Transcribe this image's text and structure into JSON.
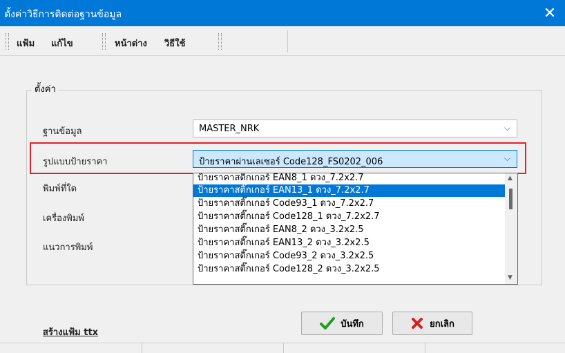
{
  "window": {
    "title": "ตั้งค่าวิธีการติดต่อฐานข้อมูล"
  },
  "menu": [
    "แฟ้ม",
    "แก้ไข",
    "หน้าต่าง",
    "วิธีใช้"
  ],
  "group": {
    "title": "ตั้งค่า"
  },
  "fields": {
    "database": {
      "label": "ฐานข้อมูล",
      "value": "MASTER_NRK"
    },
    "label_format": {
      "label": "รูปแบบป้ายราคา",
      "value": "ป้ายราคาผ่านเลเซอร์ Code128_FS0202_006"
    },
    "print_where": {
      "label": "พิมพ์ที่ใด"
    },
    "printer": {
      "label": "เครื่องพิมพ์"
    },
    "orientation": {
      "label": "แนวการพิมพ์"
    }
  },
  "dropdown_options": [
    "ป้ายราคาสติ๊กเกอร์ EAN8_1 ดวง_7.2x2.7",
    "ป้ายราคาสติ๊กเกอร์ EAN13_1 ดวง_7.2x2.7",
    "ป้ายราคาสติ๊กเกอร์ Code93_1 ดวง_7.2x2.7",
    "ป้ายราคาสติ๊กเกอร์ Code128_1 ดวง_7.2x2.7",
    "ป้ายราคาสติ๊กเกอร์ EAN8_2 ดวง_3.2x2.5",
    "ป้ายราคาสติ๊กเกอร์ EAN13_2 ดวง_3.2x2.5",
    "ป้ายราคาสติ๊กเกอร์ Code93_2 ดวง_3.2x2.5",
    "ป้ายราคาสติ๊กเกอร์ Code128_2 ดวง_3.2x2.5"
  ],
  "selected_option_index": 1,
  "buttons": {
    "save": "บันทึก",
    "cancel": "ยกเลิก"
  },
  "link": {
    "create_ttx": "สร้างแฟ้ม ttx"
  },
  "icons": {
    "save": "checkmark-icon",
    "cancel": "x-icon",
    "close": "close-icon"
  },
  "colors": {
    "titlebar": "#0078d7",
    "highlight": "#e0202a",
    "check": "#1e9e1e",
    "cross": "#d91e1e"
  }
}
